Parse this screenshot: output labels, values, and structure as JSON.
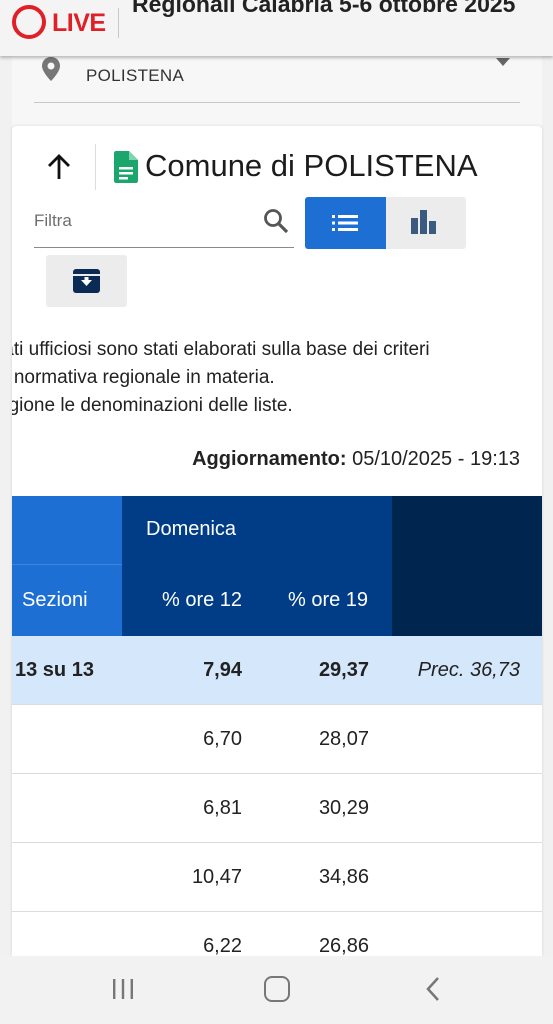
{
  "topbar": {
    "logo_text": "LIVE",
    "title": "Regionali Calabria 5-6 ottobre 2025"
  },
  "location": {
    "selected": "POLISTENA",
    "icon": "location-pin-icon"
  },
  "card": {
    "title": "Comune di POLISTENA",
    "filter_placeholder": "Filtra",
    "icons": [
      "arrow-up-icon",
      "document-icon",
      "search-icon",
      "list-icon",
      "bar-chart-icon",
      "archive-download-icon"
    ]
  },
  "disclaimer": [
    "tati ufficiosi sono stati elaborati sulla base dei criteri",
    "a normativa regionale in materia.",
    "egione le denominazioni delle liste."
  ],
  "update": {
    "label": "Aggiornamento:",
    "value": "05/10/2025 - 19:13"
  },
  "table": {
    "group_header": "Domenica",
    "headers": {
      "sezioni": "Sezioni",
      "ore12": "% ore 12",
      "ore19": "% ore 19"
    },
    "total": {
      "sezioni": "13 su 13",
      "ore12": "7,94",
      "ore19": "29,37",
      "prev": "Prec. 36,73"
    },
    "rows": [
      {
        "ore12": "6,70",
        "ore19": "28,07"
      },
      {
        "ore12": "6,81",
        "ore19": "30,29"
      },
      {
        "ore12": "10,47",
        "ore19": "34,86"
      },
      {
        "ore12": "6,22",
        "ore19": "26,86"
      }
    ]
  },
  "colors": {
    "accent": "#1e6fd4",
    "header_dark": "#003d86",
    "header_darker": "#00264f",
    "live_red": "#e01f26",
    "doc_green": "#1aa66c"
  }
}
